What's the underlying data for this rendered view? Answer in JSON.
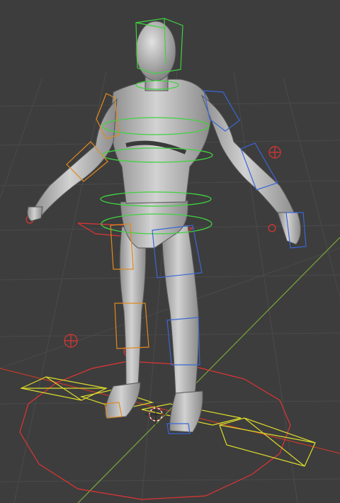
{
  "viewport": {
    "background": "#3d3d3d",
    "grid_color": "#4a4a4a",
    "x_axis_color": "#c0392b",
    "y_axis_color": "#7aa83a"
  },
  "rig": {
    "body_color": "#b7b7b7",
    "left_controls_color": "#e08a1e",
    "right_controls_color": "#3a67d6",
    "spine_controls_color": "#3fd33f",
    "ik_controls_color": "#e23434",
    "foot_roll_controls_color": "#dcdc2a",
    "head_control_color": "#3fd33f"
  }
}
